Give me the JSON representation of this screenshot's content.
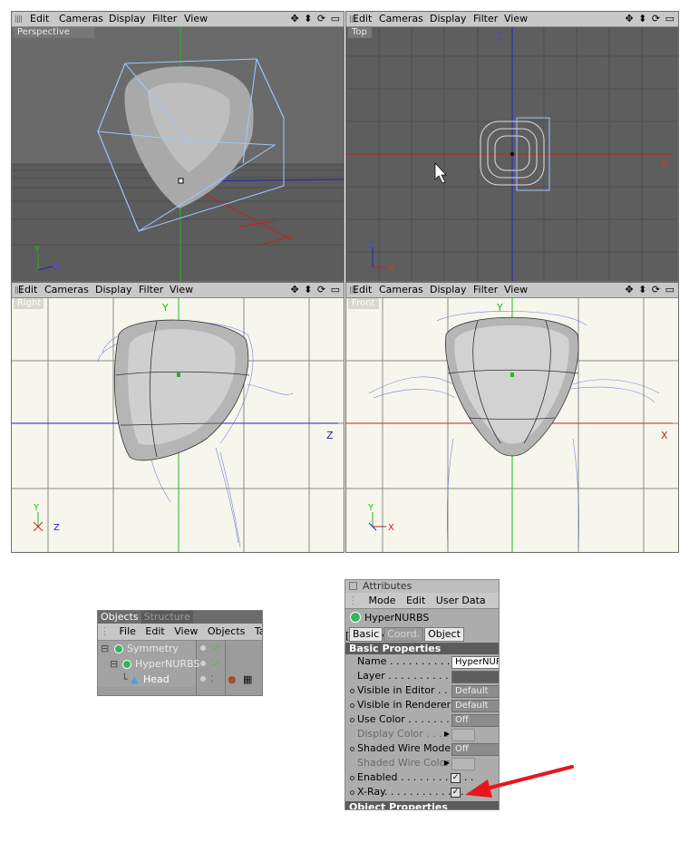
{
  "viewports": [
    {
      "menu": [
        "Edit",
        "Cameras",
        "Display",
        "Filter",
        "View"
      ],
      "nav_icons": "✥ ⬍ ⟳ ▭",
      "camera": "Perspective",
      "axis_labels": [
        "Y",
        "Z"
      ]
    },
    {
      "menu": [
        "Edit",
        "Cameras",
        "Display",
        "Filter",
        "View"
      ],
      "nav_icons": "✥ ⬍ ⟳ ▭",
      "camera": "Top",
      "axis_labels": [
        "Z",
        "X",
        "Z",
        "X"
      ]
    },
    {
      "menu": [
        "Edit",
        "Cameras",
        "Display",
        "Filter",
        "View"
      ],
      "nav_icons": "✥ ⬍ ⟳ ▭",
      "camera": "Right",
      "axis_labels": [
        "Y",
        "Z",
        "Y",
        "Z"
      ]
    },
    {
      "menu": [
        "Edit",
        "Cameras",
        "Display",
        "Filter",
        "View"
      ],
      "nav_icons": "✥ ⬍ ⟳ ▭",
      "camera": "Front",
      "axis_labels": [
        "Y",
        "X",
        "Y",
        "X"
      ]
    }
  ],
  "objects_manager": {
    "tabs": [
      "Objects",
      "Structure"
    ],
    "menu": [
      "File",
      "Edit",
      "View",
      "Objects",
      "Tags"
    ],
    "items": [
      {
        "name": "Symmetry",
        "icon": "symmetry-icon"
      },
      {
        "name": "HyperNURBS",
        "icon": "hypernurbs-icon"
      },
      {
        "name": "Head",
        "icon": "polygon-icon"
      }
    ]
  },
  "attributes": {
    "title": "Attributes",
    "menu": [
      "Mode",
      "Edit",
      "User Data"
    ],
    "object_label": "HyperNURBS [HyperNURBS]",
    "tabs": [
      "Basic",
      "Coord.",
      "Object"
    ],
    "section_basic": "Basic Properties",
    "section_object": "Object Properties",
    "properties": [
      {
        "label": "Name . . . . . . . . . . . . . . .",
        "value": "HyperNURBS",
        "kind": "light"
      },
      {
        "label": "Layer . . . . . . . . . . . . . . .",
        "value": "",
        "kind": "dark"
      },
      {
        "label": "Visible in Editor . . . . .",
        "value": "Default",
        "kind": "field"
      },
      {
        "label": "Visible in Renderer . .",
        "value": "Default",
        "kind": "field"
      },
      {
        "label": "Use Color . . . . . . . . . . .",
        "value": "Off",
        "kind": "field"
      },
      {
        "label": "Display Color . . . . .",
        "value": "",
        "kind": "swatch"
      },
      {
        "label": "Shaded Wire Mode . .",
        "value": "Off",
        "kind": "field"
      },
      {
        "label": "Shaded Wire Color",
        "value": "",
        "kind": "swatch"
      },
      {
        "label": "Enabled . . . . . . . . . . . .",
        "value": "✓",
        "kind": "check"
      },
      {
        "label": "X-Ray. . . . . . . . . . . . . . .",
        "value": "✓",
        "kind": "check"
      }
    ]
  },
  "colors": {
    "accent_arrow": "#e8161a",
    "grid_light": "#f7f6ec",
    "viewport_dark": "#5d5d5d"
  }
}
